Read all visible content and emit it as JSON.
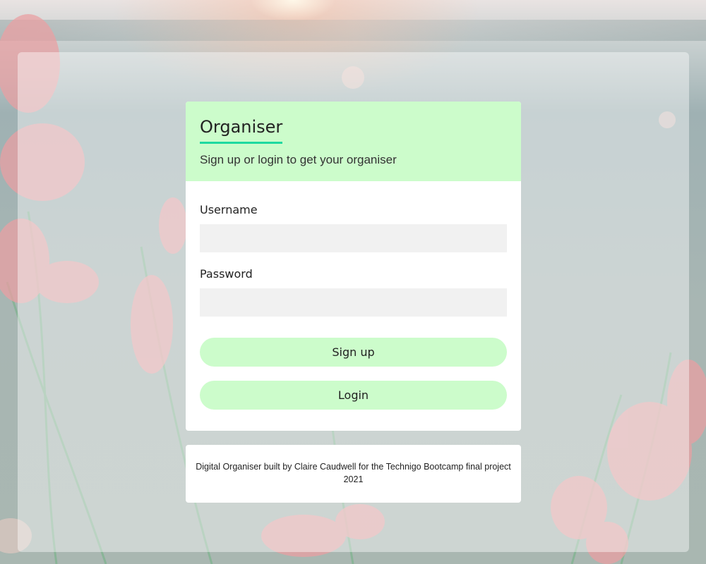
{
  "login": {
    "title": "Organiser",
    "subtitle": "Sign up or login to get your organiser",
    "username_label": "Username",
    "username_value": "",
    "password_label": "Password",
    "password_value": "",
    "signup_label": "Sign up",
    "login_label": "Login"
  },
  "footer": {
    "text": "Digital Organiser built by Claire Caudwell for the Technigo Bootcamp final project 2021"
  },
  "colors": {
    "header_bg": "#ccfccb",
    "accent_underline": "#1ed9a0",
    "input_bg": "#f1f1f1",
    "button_bg": "#ccfccb"
  }
}
